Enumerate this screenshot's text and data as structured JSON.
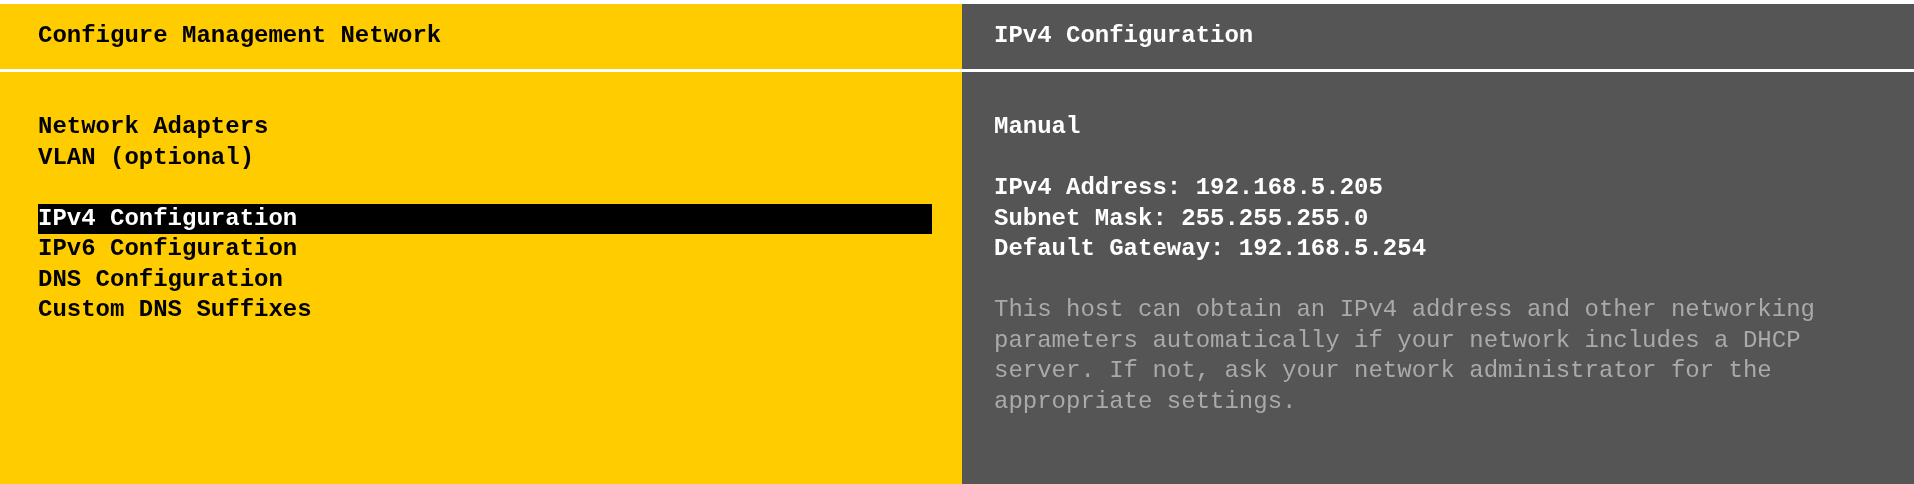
{
  "left_panel": {
    "title": "Configure Management Network",
    "menu_groups": [
      [
        {
          "label": "Network Adapters",
          "selected": false
        },
        {
          "label": "VLAN (optional)",
          "selected": false
        }
      ],
      [
        {
          "label": "IPv4 Configuration",
          "selected": true
        },
        {
          "label": "IPv6 Configuration",
          "selected": false
        },
        {
          "label": "DNS Configuration",
          "selected": false
        },
        {
          "label": "Custom DNS Suffixes",
          "selected": false
        }
      ]
    ]
  },
  "right_panel": {
    "title": "IPv4 Configuration",
    "mode": "Manual",
    "details": [
      "IPv4 Address: 192.168.5.205",
      "Subnet Mask: 255.255.255.0",
      "Default Gateway: 192.168.5.254"
    ],
    "description": "This host can obtain an IPv4 address and other networking parameters automatically if your network includes a DHCP server. If not, ask your network administrator for the appropriate settings."
  }
}
